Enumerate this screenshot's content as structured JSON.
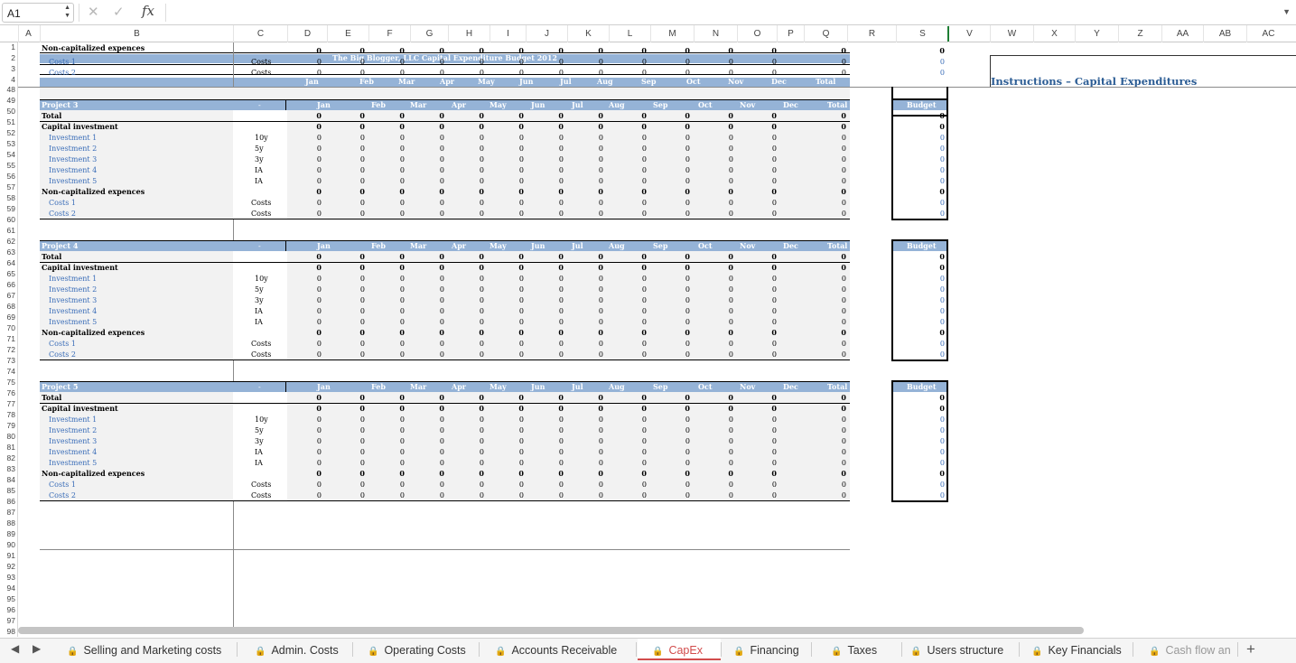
{
  "formula_bar": {
    "name_box": "A1",
    "fx": "fx",
    "content": ""
  },
  "columns": [
    "A",
    "B",
    "C",
    "D",
    "E",
    "F",
    "G",
    "H",
    "I",
    "J",
    "K",
    "L",
    "M",
    "N",
    "O",
    "P",
    "Q",
    "R",
    "S",
    "V",
    "W",
    "X",
    "Y",
    "Z",
    "AA",
    "AB",
    "AC"
  ],
  "rows": [
    "1",
    "2",
    "3",
    "4",
    "48",
    "49",
    "50",
    "51",
    "52",
    "53",
    "54",
    "55",
    "56",
    "57",
    "58",
    "59",
    "60",
    "61",
    "62",
    "63",
    "64",
    "65",
    "66",
    "67",
    "68",
    "69",
    "70",
    "71",
    "72",
    "73",
    "74",
    "75",
    "76",
    "77",
    "78",
    "79",
    "80",
    "81",
    "82",
    "83",
    "84",
    "85",
    "86",
    "87",
    "88",
    "89",
    "90",
    "91",
    "92",
    "93",
    "94",
    "95",
    "96",
    "97",
    "98"
  ],
  "sheet": {
    "title": "The Big Blogger, LLC Capital Expenditure Budget 2012",
    "instructions_title": "Instructions – Capital Expenditures",
    "months": [
      "Jan",
      "Feb",
      "Mar",
      "Apr",
      "May",
      "Jun",
      "Jul",
      "Aug",
      "Sep",
      "Oct",
      "Nov",
      "Dec"
    ],
    "total_label": "Total",
    "budget_label": "Budget",
    "dash": "-",
    "zero": "0",
    "row_total": "Total",
    "capital_investment": "Capital investment",
    "non_capitalized": "Non-capitalized expences",
    "investments": [
      {
        "label": "Investment 1",
        "term": "10y"
      },
      {
        "label": "Investment 2",
        "term": "5y"
      },
      {
        "label": "Investment 3",
        "term": "3y"
      },
      {
        "label": "Investment 4",
        "term": "IA"
      },
      {
        "label": "Investment 5",
        "term": "IA"
      }
    ],
    "costs": [
      {
        "label": "Costs 1",
        "term": "Costs"
      },
      {
        "label": "Costs 2",
        "term": "Costs"
      }
    ],
    "projects": [
      "Project 3",
      "Project 4",
      "Project 5"
    ]
  },
  "tabs": [
    {
      "label": "Selling and Marketing costs",
      "locked": true,
      "active": false
    },
    {
      "label": "Admin. Costs",
      "locked": true,
      "active": false
    },
    {
      "label": "Operating Costs",
      "locked": true,
      "active": false
    },
    {
      "label": "Accounts Receivable",
      "locked": true,
      "active": false
    },
    {
      "label": "CapEx",
      "locked": true,
      "active": true
    },
    {
      "label": "Financing",
      "locked": true,
      "active": false
    },
    {
      "label": "Taxes",
      "locked": true,
      "active": false
    },
    {
      "label": "Users structure",
      "locked": true,
      "active": false
    },
    {
      "label": "Key Financials",
      "locked": true,
      "active": false
    },
    {
      "label": "Cash flow an",
      "locked": true,
      "active": false
    }
  ],
  "colors": {
    "header_blue": "#95b3d7",
    "link_blue": "#3a6db8",
    "active_tab": "#d24c4c",
    "row_shade": "#f2f2f2"
  }
}
